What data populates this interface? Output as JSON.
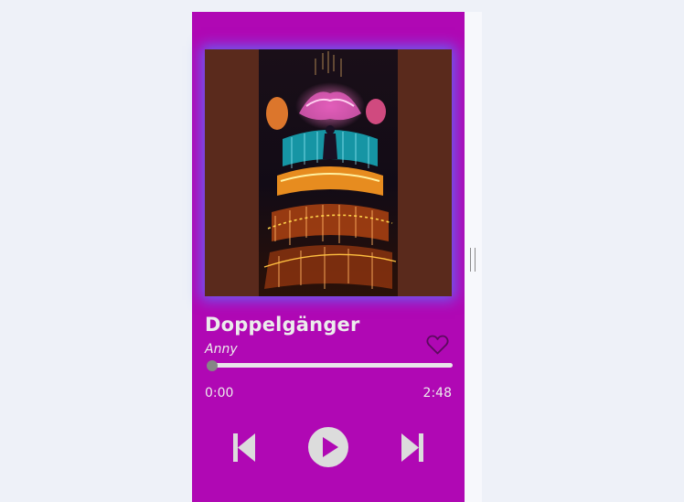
{
  "track": {
    "title": "Doppelgänger",
    "artist": "Anny"
  },
  "progress": {
    "current_time": "0:00",
    "total_time": "2:48",
    "fraction": 0
  },
  "icons": {
    "favorite": "heart-outline-icon",
    "previous": "skip-previous-icon",
    "play": "play-circle-icon",
    "next": "skip-next-icon"
  },
  "colors": {
    "player_background": "#b008b4",
    "album_glow": "#5a6eff",
    "text": "#ececec",
    "controls": "#dcdcdc"
  }
}
